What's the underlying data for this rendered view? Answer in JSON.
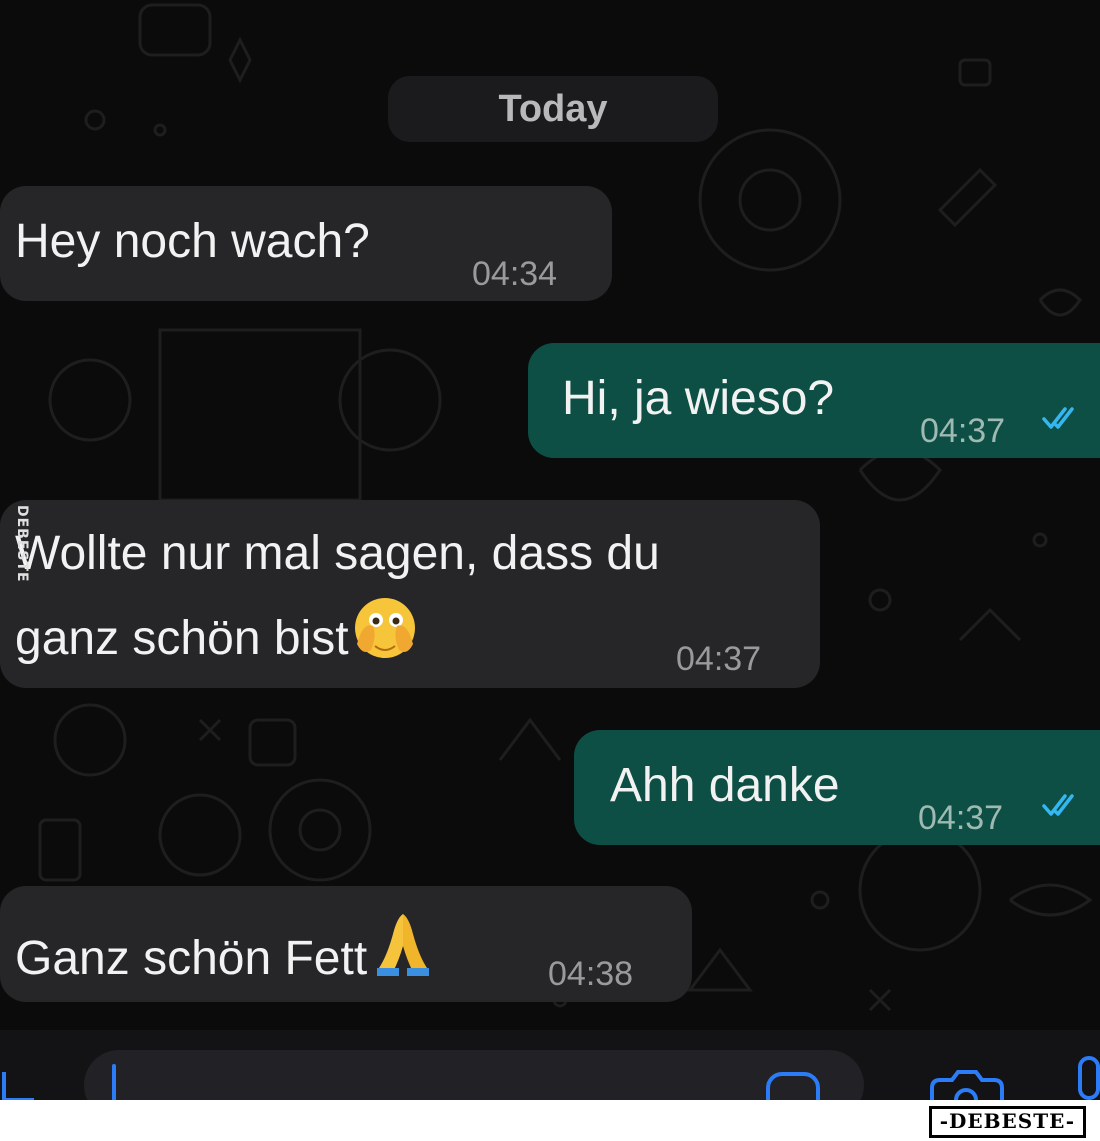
{
  "date_separator": "Today",
  "messages": [
    {
      "direction": "incoming",
      "line1": "Hey noch wach?",
      "line2": "",
      "emoji": "",
      "time": "04:34"
    },
    {
      "direction": "outgoing",
      "line1": "Hi, ja wieso?",
      "line2": "",
      "emoji": "",
      "time": "04:37",
      "status": "read"
    },
    {
      "direction": "incoming",
      "line1": "Wollte nur mal sagen, dass du",
      "line2": "ganz schön bist",
      "emoji": "face-with-open-eyes-and-hand-over-mouth",
      "time": "04:37"
    },
    {
      "direction": "outgoing",
      "line1": "Ahh danke",
      "line2": "",
      "emoji": "",
      "time": "04:37",
      "status": "read"
    },
    {
      "direction": "incoming",
      "line1": "Ganz schön Fett",
      "line2": "",
      "emoji": "folded-hands",
      "time": "04:38"
    }
  ],
  "watermark": "-DEBESTE-",
  "side_watermark": "DEBESTE",
  "icons": [
    "plus-icon",
    "sticker-icon",
    "camera-icon",
    "microphone-icon",
    "double-check-icon"
  ],
  "colors": {
    "incoming": "#262628",
    "outgoing": "#0d4f44",
    "read_ticks": "#34b7f1"
  }
}
